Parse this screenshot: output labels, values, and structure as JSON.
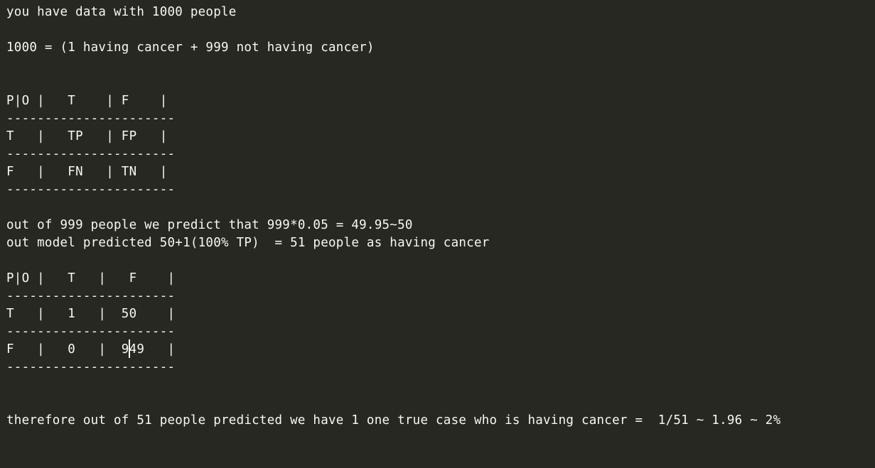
{
  "editor": {
    "lines": [
      "you have data with 1000 people",
      "",
      "1000 = (1 having cancer + 999 not having cancer)",
      "",
      "",
      "P|O |   T    | F    |",
      "----------------------",
      "T   |   TP   | FP   |",
      "----------------------",
      "F   |   FN   | TN   |",
      "----------------------",
      "",
      "out of 999 people we predict that 999*0.05 = 49.95~50",
      "out model predicted 50+1(100% TP)  = 51 people as having cancer",
      "",
      "P|O |   T   |   F    |",
      "----------------------",
      "T   |   1   |  50    |",
      "----------------------",
      "F   |   0   |  949   |",
      "----------------------",
      "",
      "",
      "therefore out of 51 people predicted we have 1 one true case who is having cancer =  1/51 ~ 1.96 ~ 2%"
    ]
  }
}
